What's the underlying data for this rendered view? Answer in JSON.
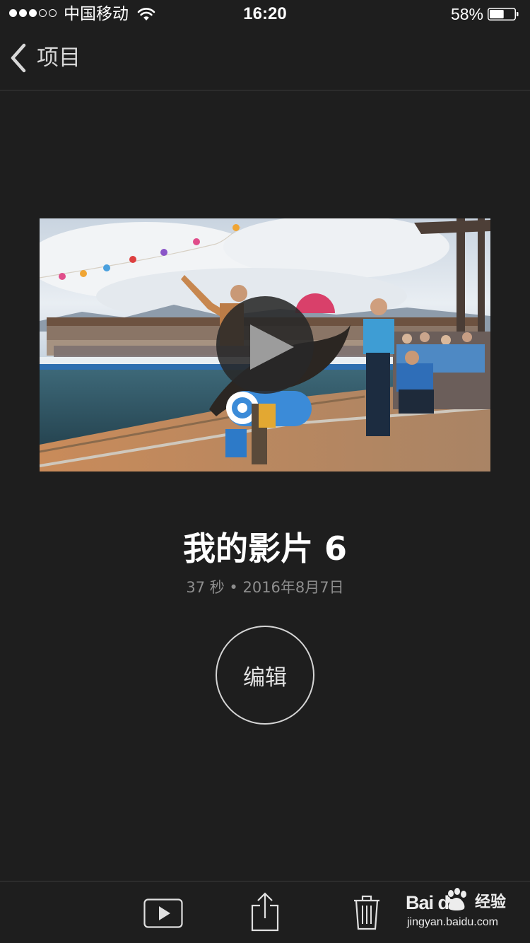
{
  "status_bar": {
    "carrier": "中国移动",
    "time": "16:20",
    "battery_percent": "58%",
    "battery_level": 0.58,
    "signal_bars_filled": 3,
    "signal_bars_total": 5
  },
  "nav": {
    "back_label": "项目",
    "back_icon": "chevron-left-icon"
  },
  "video": {
    "play_icon": "play-icon"
  },
  "project": {
    "title": "我的影片 6",
    "meta": "37 秒 • 2016年8月7日"
  },
  "edit_button": {
    "label": "编辑"
  },
  "toolbar": {
    "icons": [
      "play-icon",
      "share-icon",
      "trash-icon"
    ]
  },
  "watermark": {
    "brand": "Bai  du",
    "product": "经验",
    "url": "jingyan.baidu.com"
  },
  "colors": {
    "background": "#1e1e1e",
    "text_primary": "#ffffff",
    "text_secondary": "#8e8e8e",
    "divider": "#3a3a3a"
  }
}
